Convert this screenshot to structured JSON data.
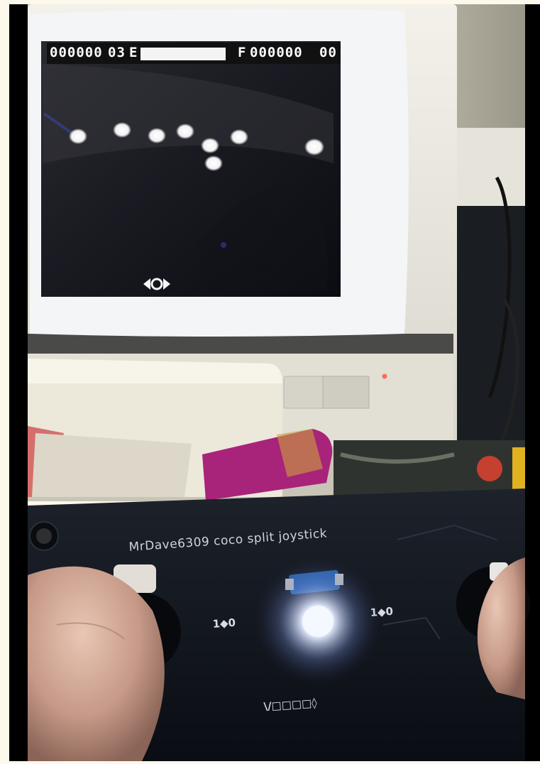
{
  "game_hud": {
    "left_score": "000000",
    "left_lives": "03",
    "fuel_empty_label": "E",
    "fuel_full_label": "F",
    "right_score": "000000",
    "right_lives": "00",
    "fuel_level": 1.0
  },
  "board": {
    "silkscreen_title": "MrDave6309 coco split joystick",
    "left_pad_label": "1◆0",
    "right_pad_label": "1◆0",
    "header_label": "\\/□□□□◊"
  },
  "colors": {
    "frame_bar": "#000000",
    "monitor_bezel": "#ece9e0",
    "game_screen": "#0d0f18",
    "pcb": "#141820",
    "led": "#e8f0ff",
    "cartridge": "#a8237a"
  },
  "icons": [
    "enemy-saucer-icon",
    "player-ship-icon",
    "power-led-icon",
    "status-led-icon"
  ]
}
